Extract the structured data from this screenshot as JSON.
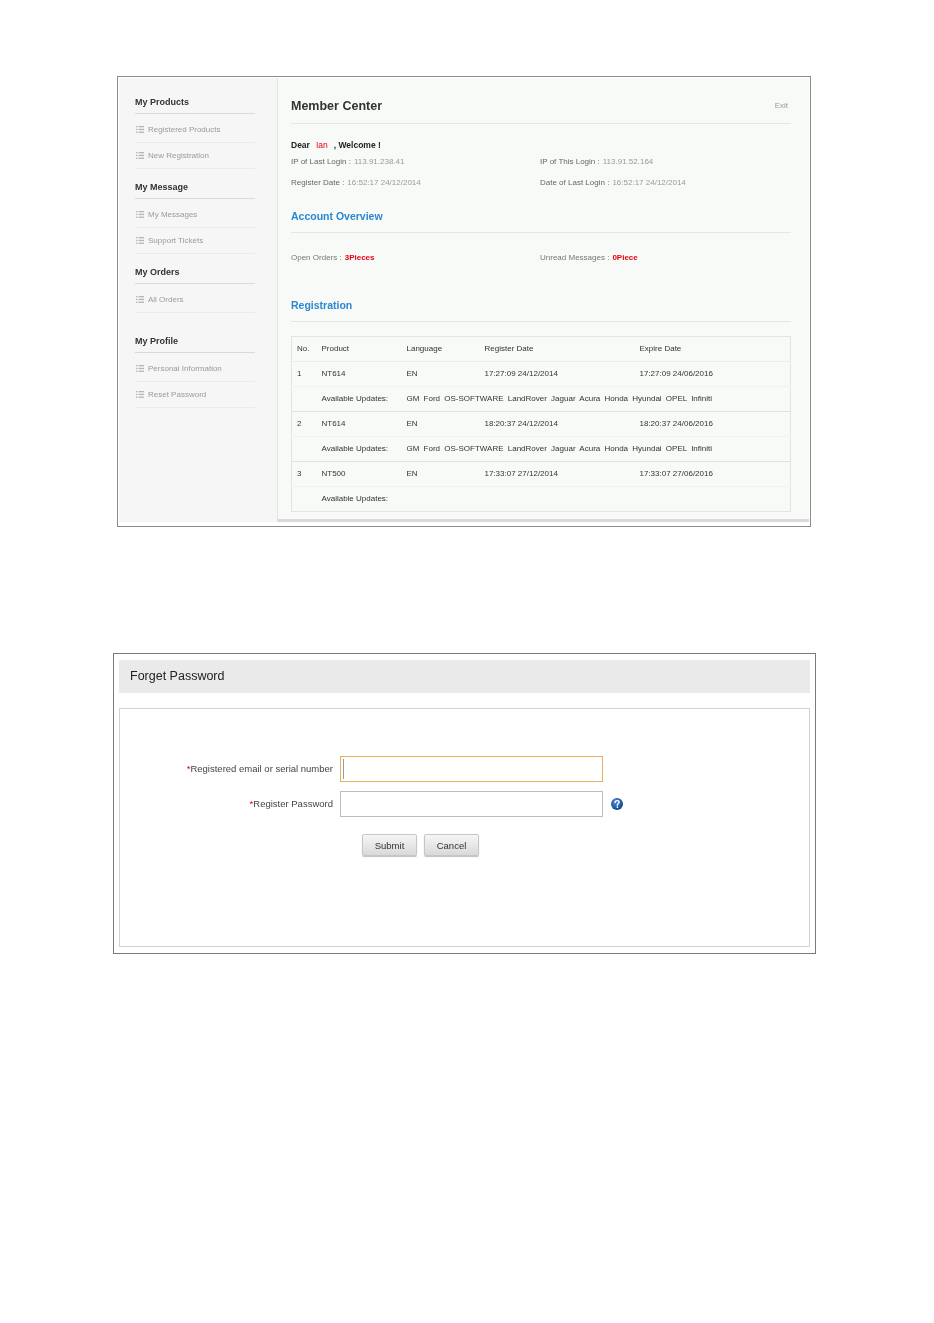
{
  "member_center": {
    "sidebar": {
      "sections": [
        {
          "title": "My Products",
          "items": [
            {
              "label": "Registered Products",
              "selected": false
            },
            {
              "label": "New Registration",
              "selected": false
            }
          ]
        },
        {
          "title": "My Message",
          "items": [
            {
              "label": "My Messages",
              "selected": false
            },
            {
              "label": "Support Tickets",
              "selected": false
            }
          ]
        },
        {
          "title": "My Orders",
          "items": [
            {
              "label": "All Orders",
              "selected": false
            }
          ]
        },
        {
          "title": "My Profile",
          "items": [
            {
              "label": "Personal Information",
              "selected": false
            },
            {
              "label": "Reset Password",
              "selected": false
            }
          ]
        }
      ]
    },
    "title": "Member Center",
    "exit_link": "Exit",
    "greeting": {
      "prefix": "Dear",
      "name": "Ian",
      "suffix": ", Welcome !"
    },
    "login_info": [
      {
        "label": "IP of Last Login :",
        "value": "113.91.238.41"
      },
      {
        "label": "IP of This Login :",
        "value": "113.91.52.164"
      },
      {
        "label": "Register Date  :",
        "value": "16:52:17 24/12/2014"
      },
      {
        "label": "Date of Last Login :",
        "value": "16:52:17 24/12/2014"
      }
    ],
    "account_overview": {
      "title": "Account Overview",
      "stats": [
        {
          "label": "Open Orders :",
          "value": "3Pieces"
        },
        {
          "label": "Unread Messages :",
          "value": "0Piece"
        }
      ]
    },
    "registration": {
      "title": "Registration",
      "table": {
        "columns": [
          "No.",
          "Product",
          "Language",
          "Register Date",
          "Expire Date"
        ],
        "rows": [
          {
            "no": "1",
            "product": "NT614",
            "language": "EN",
            "register_date": "17:27:09 24/12/2014",
            "expire_date": "17:27:09 24/06/2016",
            "updates_label": "Available Updates:",
            "updates": "GM Ford OS-SOFTWARE LandRover Jaguar Acura Honda Hyundai OPEL Infiniti"
          },
          {
            "no": "2",
            "product": "NT614",
            "language": "EN",
            "register_date": "18:20:37 24/12/2014",
            "expire_date": "18:20:37 24/06/2016",
            "updates_label": "Available Updates:",
            "updates": "GM Ford OS-SOFTWARE LandRover Jaguar Acura Honda Hyundai OPEL Infiniti"
          },
          {
            "no": "3",
            "product": "NT500",
            "language": "EN",
            "register_date": "17:33:07 27/12/2014",
            "expire_date": "17:33:07 27/06/2016",
            "updates_label": "Available Updates:"
          }
        ]
      }
    }
  },
  "forget_password": {
    "title": "Forget Password",
    "fields": [
      {
        "required_mark": "*",
        "label": "Registered email or serial number",
        "focused": true,
        "help": false
      },
      {
        "required_mark": "*",
        "label": "Register Password",
        "focused": false,
        "help": true
      }
    ],
    "buttons": [
      {
        "label": "Submit"
      },
      {
        "label": "Cancel"
      }
    ]
  }
}
